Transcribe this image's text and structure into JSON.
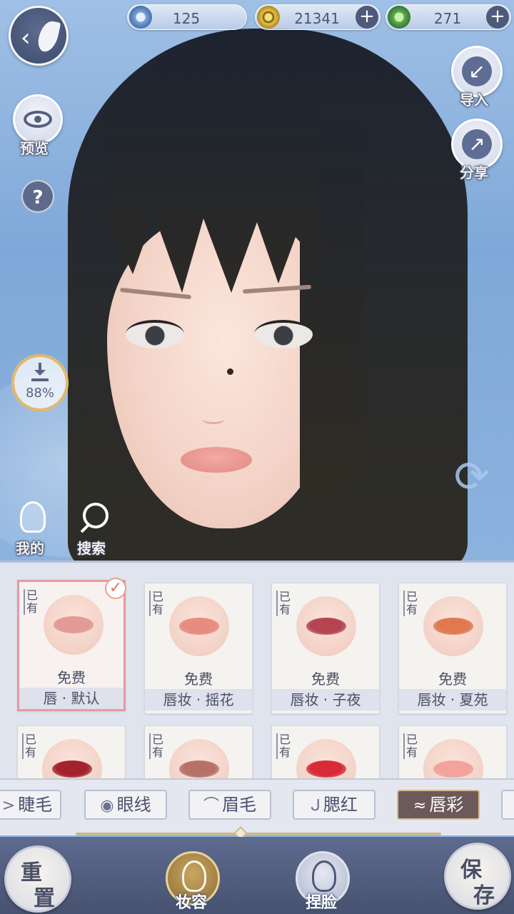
{
  "currencies": [
    {
      "value": "125",
      "icon": "silver-jade-icon"
    },
    {
      "value": "21341",
      "icon": "gold-coin-icon"
    },
    {
      "value": "271",
      "icon": "green-token-icon"
    }
  ],
  "left_controls": {
    "preview_label": "预览",
    "help_label": "?",
    "download_progress": "88%",
    "mine_label": "我的",
    "search_label": "搜索"
  },
  "right_controls": {
    "import_label": "导入",
    "share_label": "分享"
  },
  "items": [
    {
      "owned": "已有",
      "price": "免费",
      "name": "唇 · 默认",
      "selected": true,
      "lip_color": "#e39a95"
    },
    {
      "owned": "已有",
      "price": "免费",
      "name": "唇妆 · 摇花",
      "selected": false,
      "lip_color": "#e98c80"
    },
    {
      "owned": "已有",
      "price": "免费",
      "name": "唇妆 · 子夜",
      "selected": false,
      "lip_color": "#b54450"
    },
    {
      "owned": "已有",
      "price": "免费",
      "name": "唇妆 · 夏苑",
      "selected": false,
      "lip_color": "#e07a4e"
    },
    {
      "owned": "已有",
      "lip_color": "#a4222e"
    },
    {
      "owned": "已有",
      "lip_color": "#b87166"
    },
    {
      "owned": "已有",
      "lip_color": "#d92b35"
    },
    {
      "owned": "已有",
      "lip_color": "#f3a39c"
    }
  ],
  "tabs": [
    {
      "label": "睫毛",
      "icon": "eyelash-icon"
    },
    {
      "label": "眼线",
      "icon": "eye-icon"
    },
    {
      "label": "眉毛",
      "icon": "eyebrow-icon"
    },
    {
      "label": "腮红",
      "icon": "blush-icon"
    },
    {
      "label": "唇彩",
      "icon": "lips-icon",
      "active": true
    }
  ],
  "bottom": {
    "reset_label_1": "重",
    "reset_label_2": "置",
    "makeup_label": "妆容",
    "face_label": "捏脸",
    "save_label_1": "保",
    "save_label_2": "存"
  },
  "colors": {
    "accent_gold": "#cbb98d",
    "selected_border": "#e79a9e",
    "bar_blue": "#5f6b8f"
  }
}
